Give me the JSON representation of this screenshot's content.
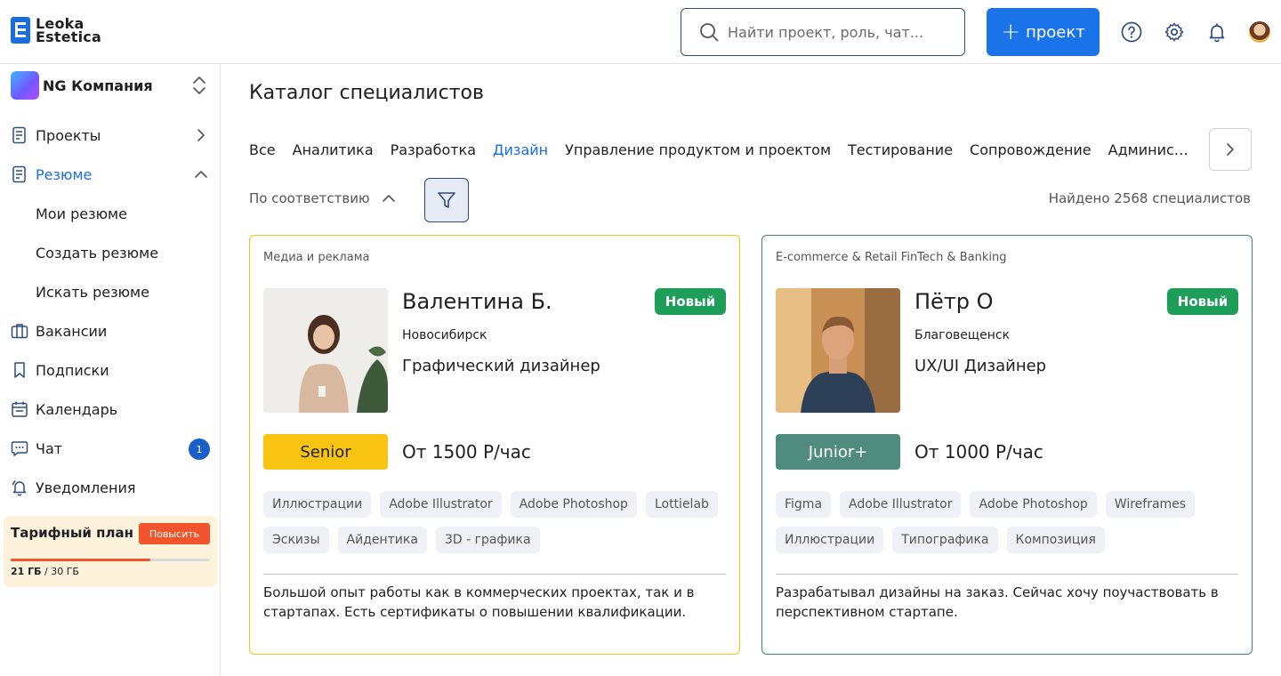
{
  "header": {
    "logo": "Leoka Estetica",
    "search_placeholder": "Найти проект, роль, чат...",
    "new_project_label": "проект"
  },
  "sidebar": {
    "company": "NG Компания",
    "items": [
      {
        "label": "Проекты"
      },
      {
        "label": "Резюме"
      },
      {
        "label": "Мои резюме"
      },
      {
        "label": "Создать резюме"
      },
      {
        "label": "Искать резюме"
      },
      {
        "label": "Вакансии"
      },
      {
        "label": "Подписки"
      },
      {
        "label": "Календарь"
      },
      {
        "label": "Чат",
        "badge": "1"
      },
      {
        "label": "Уведомления"
      }
    ],
    "plan": {
      "title": "Тарифный план",
      "upgrade": "Повысить",
      "used": "21 ГБ",
      "total": "/ 30 ГБ",
      "fraction": 0.7
    }
  },
  "main": {
    "title": "Каталог специалистов",
    "tabs": [
      "Все",
      "Аналитика",
      "Разработка",
      "Дизайн",
      "Управление продуктом и проектом",
      "Тестирование",
      "Сопровождение",
      "Администрирование"
    ],
    "sort_label": "По соответствию",
    "found": "Найдено 2568 специалистов",
    "cards": [
      {
        "industry": "Медиа и реклама",
        "name": "Валентина Б.",
        "badge": "Новый",
        "city": "Новосибирск",
        "role": "Графический дизайнер",
        "level": "Senior",
        "rate": "От 1500 Р/час",
        "skills": [
          "Иллюстрации",
          "Adobe Illustrator",
          "Adobe Photoshop",
          "Lottielab",
          "Эскизы",
          "Айдентика",
          "3D - графика"
        ],
        "description": "Большой опыт работы как в коммерческих проектах, так и в стартапах. Есть сертификаты о повышении квалификации."
      },
      {
        "industry": "E-commerce & Retail FinTech & Banking",
        "name": "Пётр О",
        "badge": "Новый",
        "city": "Благовещенск",
        "role": "UX/UI Дизайнер",
        "level": "Junior+",
        "rate": "От 1000 Р/час",
        "skills": [
          "Figma",
          "Adobe Illustrator",
          "Adobe Photoshop",
          "Wireframes",
          "Иллюстрации",
          "Типографика",
          "Композиция"
        ],
        "description": "Разрабатывал дизайны на заказ. Сейчас хочу поучаствовать в перспективном стартапе."
      }
    ]
  }
}
